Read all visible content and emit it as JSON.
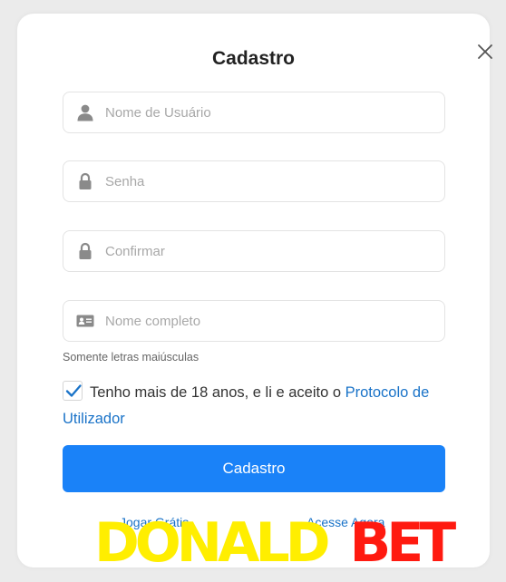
{
  "dialog": {
    "title": "Cadastro",
    "close_icon": "close-icon"
  },
  "fields": {
    "username": {
      "placeholder": "Nome de Usuário",
      "value": "",
      "icon": "user-icon"
    },
    "password": {
      "placeholder": "Senha",
      "value": "",
      "icon": "lock-icon"
    },
    "confirm": {
      "placeholder": "Confirmar",
      "value": "",
      "icon": "lock-icon"
    },
    "fullname": {
      "placeholder": "Nome completo",
      "value": "",
      "icon": "id-card-icon"
    }
  },
  "hint": "Somente letras maiúsculas",
  "agreement": {
    "checked": true,
    "text": "Tenho mais de 18 anos, e li e aceito o ",
    "link": "Protocolo de Utilizador"
  },
  "submit_label": "Cadastro",
  "footer": {
    "left_link": "Jogar Grátis",
    "right_link": "Acesse Agora"
  },
  "watermark": {
    "part1": "DONALD",
    "part2": "BET"
  },
  "colors": {
    "accent": "#1a82f8",
    "link": "#1a73c8",
    "watermark_yellow": "#ffee00",
    "watermark_red": "#ff1a10"
  }
}
